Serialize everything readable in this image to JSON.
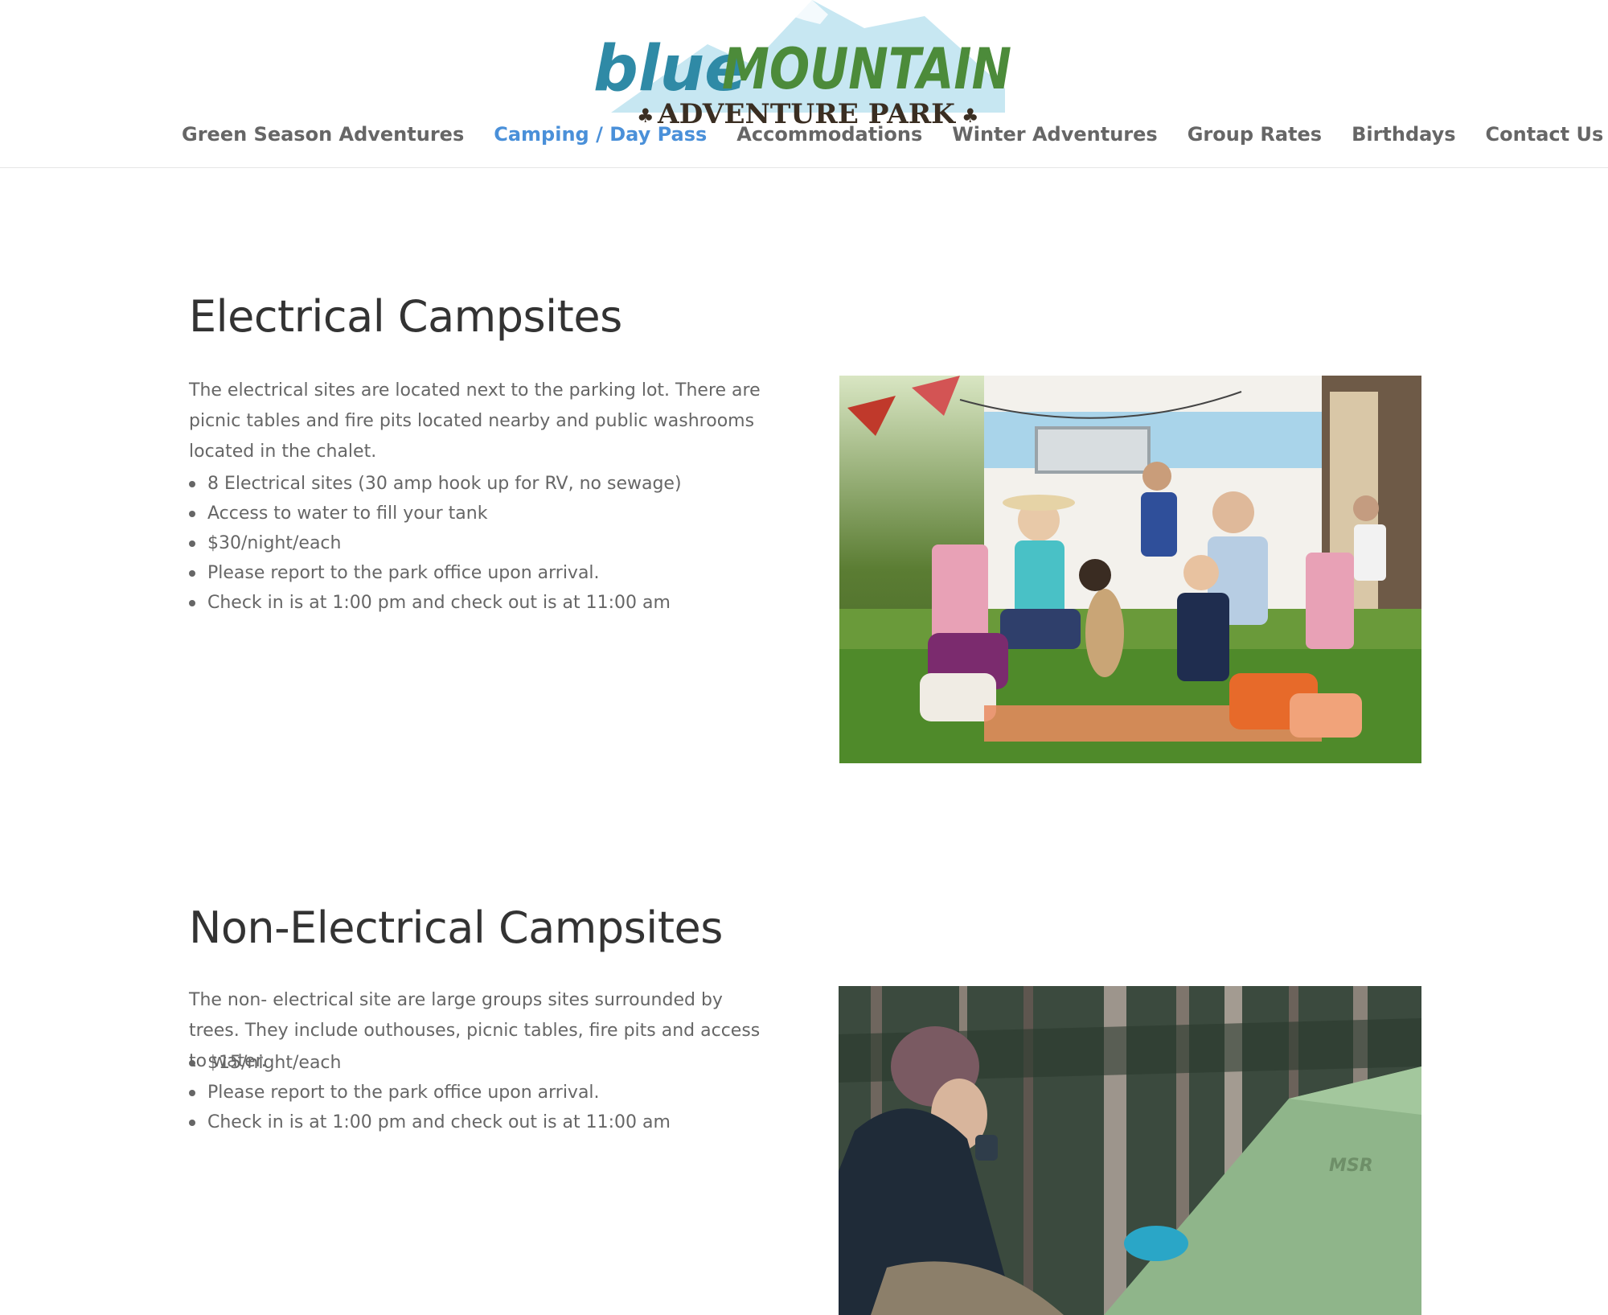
{
  "brand": {
    "logo_word_blue": "blue",
    "logo_word_mountain": "MOUNTAIN",
    "logo_subtitle": "ADVENTURE PARK",
    "colors": {
      "blue": "#2f8aa6",
      "green": "#4c8b3a",
      "dark": "#3a2e22",
      "sky": "#bfe3ef"
    }
  },
  "nav": {
    "items": [
      {
        "label": "Green Season Adventures",
        "active": false
      },
      {
        "label": "Camping / Day Pass",
        "active": true
      },
      {
        "label": "Accommodations",
        "active": false
      },
      {
        "label": "Winter Adventures",
        "active": false
      },
      {
        "label": "Group Rates",
        "active": false
      },
      {
        "label": "Birthdays",
        "active": false
      },
      {
        "label": "Contact Us",
        "active": false
      }
    ],
    "active_color": "#4a90d9"
  },
  "electrical": {
    "title": "Electrical Campsites",
    "intro": "The electrical sites are located next to the parking lot. There are picnic tables and fire pits located nearby and public washrooms located in the chalet.",
    "bullets": [
      "8 Electrical sites (30 amp hook up for RV, no sewage)",
      "Access to water to fill your tank",
      "$30/night/each",
      "Please report to the park office upon arrival.",
      "Check in is at 1:00 pm and check out is at 11:00 am"
    ]
  },
  "non_electrical": {
    "title": "Non-Electrical Campsites",
    "intro": "The non- electrical site are large groups sites surrounded by trees. They include outhouses, picnic tables, fire pits and access to water.",
    "bullets": [
      "$15/night/each",
      "Please report to the park office upon arrival.",
      "Check in is at 1:00 pm and check out is at 11:00 am"
    ]
  },
  "photos": {
    "tent_brand": "MSR"
  }
}
